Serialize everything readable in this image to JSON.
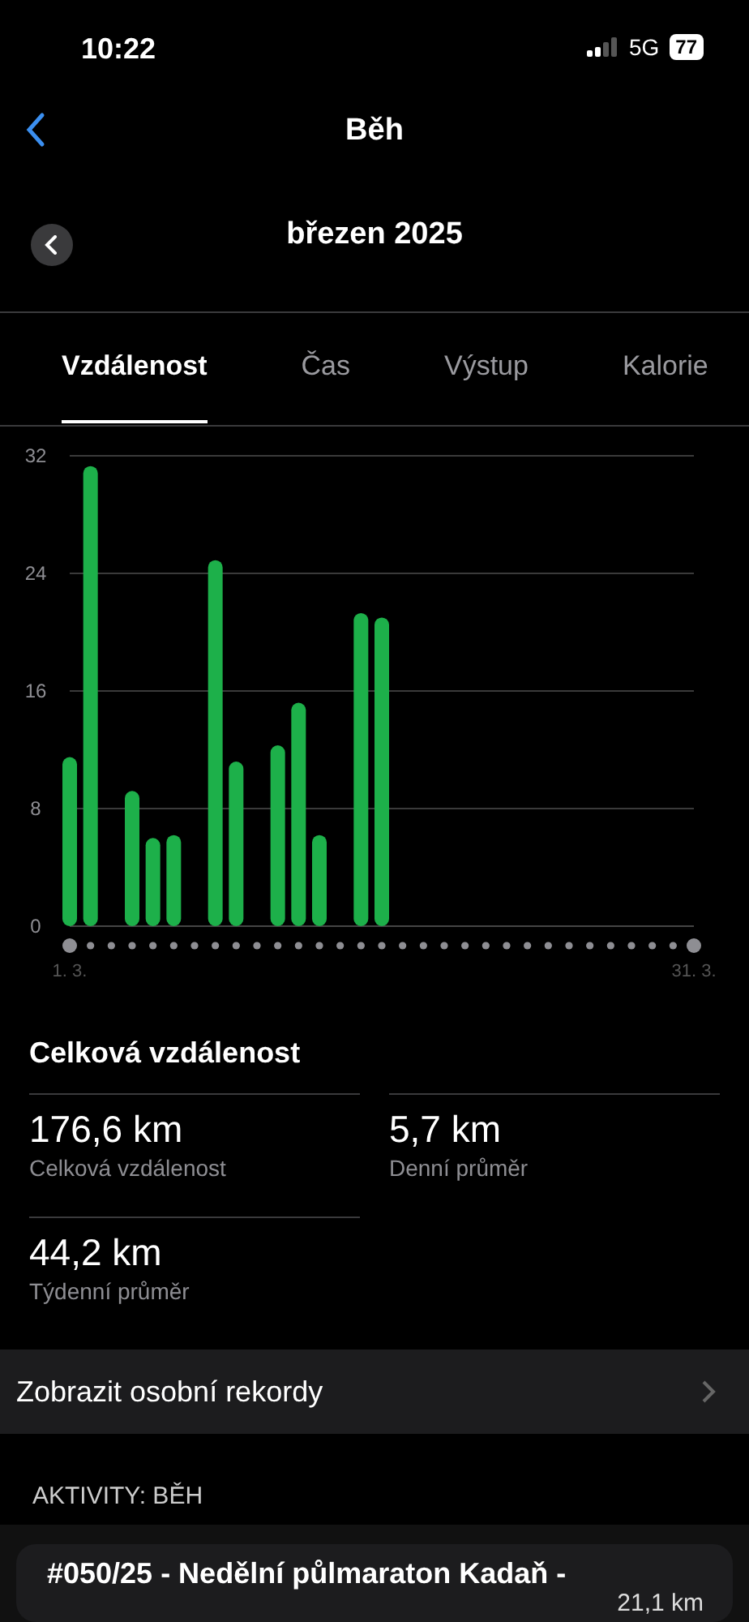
{
  "status_bar": {
    "time": "10:22",
    "network": "5G",
    "battery": "77"
  },
  "header": {
    "title": "Běh"
  },
  "period": {
    "label": "březen 2025"
  },
  "tabs": [
    {
      "label": "Vzdálenost",
      "selected": true
    },
    {
      "label": "Čas",
      "selected": false
    },
    {
      "label": "Výstup",
      "selected": false
    },
    {
      "label": "Kalorie",
      "selected": false
    }
  ],
  "chart_data": {
    "type": "bar",
    "categories": [
      "1. 3.",
      null,
      null,
      null,
      null,
      null,
      null,
      null,
      null,
      null,
      null,
      null,
      null,
      null,
      null,
      null,
      null,
      null,
      null,
      null,
      null,
      null,
      null,
      null,
      null,
      null,
      null,
      null,
      null,
      null,
      "31. 3."
    ],
    "series": [
      {
        "color": "#1db04a",
        "values": [
          11.5,
          31.3,
          0,
          9.2,
          6,
          6.2,
          0,
          24.9,
          11.2,
          0,
          12.3,
          15.2,
          6.2,
          0,
          21.3,
          21,
          0,
          0,
          0,
          0,
          0,
          0,
          0,
          0,
          0,
          0,
          0,
          0,
          0,
          0,
          0
        ]
      }
    ],
    "ylim": [
      0,
      32
    ],
    "yticks": [
      0,
      8,
      16,
      24,
      32
    ],
    "grid": true
  },
  "summary": {
    "title": "Celková vzdálenost",
    "stats": [
      {
        "value": "176,6 km",
        "label": "Celková vzdálenost"
      },
      {
        "value": "5,7 km",
        "label": "Denní průměr"
      },
      {
        "value": "44,2 km",
        "label": "Týdenní průměr"
      }
    ]
  },
  "records_link": {
    "label": "Zobrazit osobní rekordy"
  },
  "activities": {
    "heading": "AKTIVITY: BĚH",
    "items": [
      {
        "title": "#050/25 - Nedělní půlmaraton Kadaň -",
        "distance": "21,1 km"
      }
    ]
  }
}
